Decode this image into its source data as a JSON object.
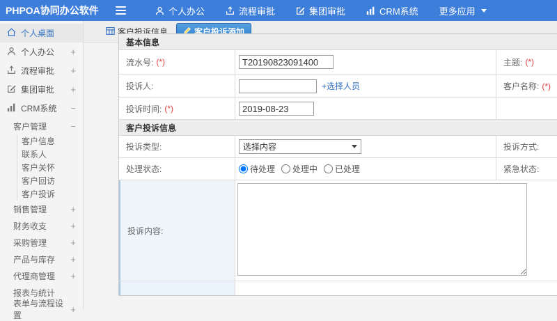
{
  "colors": {
    "header_bg": "#3d7edb",
    "active_tab_bg": "#2d7cc9",
    "link": "#3273c5",
    "required": "#e33c3c",
    "sidebar_active_text": "#3576c8"
  },
  "icons": {
    "hamburger": "three-bars",
    "user": "person-outline",
    "flow": "arrow-up-from-tray",
    "group_edit": "pencil-square",
    "crm": "bar-chart",
    "caret_down": "triangle-down",
    "home": "house-outline",
    "tab_list": "table-grid",
    "tab_add": "pencil-yellow"
  },
  "header": {
    "logo": "PHPOA协同办公软件",
    "nav": [
      {
        "label": "个人办公"
      },
      {
        "label": "流程审批"
      },
      {
        "label": "集团审批"
      },
      {
        "label": "CRM系统"
      },
      {
        "label": "更多应用"
      }
    ]
  },
  "sidebar": {
    "top_items": [
      {
        "label": "个人桌面",
        "suffix": "",
        "active": true
      },
      {
        "label": "个人办公",
        "suffix": "+"
      },
      {
        "label": "流程审批",
        "suffix": "+"
      },
      {
        "label": "集团审批",
        "suffix": "+"
      },
      {
        "label": "CRM系统",
        "suffix": "−"
      }
    ],
    "crm_children": [
      {
        "label": "客户管理",
        "suffix": "−",
        "children": [
          "客户信息",
          "联系人",
          "客户关怀",
          "客户回访",
          "客户投诉"
        ]
      },
      {
        "label": "销售管理",
        "suffix": "+"
      },
      {
        "label": "财务收支",
        "suffix": "+"
      },
      {
        "label": "采购管理",
        "suffix": "+"
      },
      {
        "label": "产品与库存",
        "suffix": "+"
      },
      {
        "label": "代理商管理",
        "suffix": "+"
      },
      {
        "label": "报表与统计",
        "suffix": ""
      },
      {
        "label": "表单与流程设置",
        "suffix": "+"
      }
    ]
  },
  "tabs": [
    {
      "label": "客户投诉信息",
      "active": false
    },
    {
      "label": "客户投诉添加",
      "active": true
    }
  ],
  "form": {
    "required_mark": "(*)",
    "section1_title": "基本信息",
    "section2_title": "客户投诉信息",
    "serial": {
      "label": "流水号:",
      "value": "T20190823091400"
    },
    "subject": {
      "label": "主题:"
    },
    "complainant": {
      "label": "投诉人:",
      "value": "",
      "action_label": "+选择人员"
    },
    "customer": {
      "label": "客户名称:"
    },
    "time": {
      "label": "投诉时间:",
      "value": "2019-08-23"
    },
    "type": {
      "label": "投诉类型:",
      "value": "选择内容"
    },
    "method": {
      "label": "投诉方式:"
    },
    "status": {
      "label": "处理状态:",
      "options": [
        "待处理",
        "处理中",
        "已处理"
      ],
      "selected": "待处理"
    },
    "urgency": {
      "label": "紧急状态:"
    },
    "content": {
      "label": "投诉内容:",
      "value": ""
    }
  }
}
